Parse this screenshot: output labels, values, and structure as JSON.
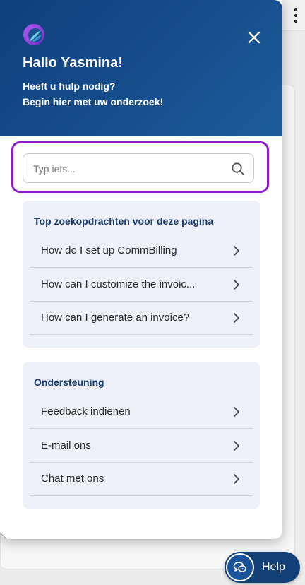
{
  "widget": {
    "greeting": "Hallo Yasmina!",
    "subtitle_line1": "Heeft u hulp nodig?",
    "subtitle_line2": "Begin hier met uw onderzoek!",
    "header_color": "#14467f",
    "accent_outline_color": "#8a1fc9",
    "logo_icon": "brand-logo-icon",
    "close_icon": "close-icon"
  },
  "search": {
    "placeholder": "Typ iets...",
    "value": "",
    "icon": "search-icon"
  },
  "top_searches": {
    "title": "Top zoekopdrachten voor deze pagina",
    "items": [
      {
        "label": "How do I set up CommBilling"
      },
      {
        "label": "How can I customize the invoic..."
      },
      {
        "label": "How can I generate an invoice?"
      }
    ]
  },
  "support": {
    "title": "Ondersteuning",
    "items": [
      {
        "label": "Feedback indienen"
      },
      {
        "label": "E-mail ons"
      },
      {
        "label": "Chat met ons"
      }
    ]
  },
  "help_button": {
    "label": "Help",
    "icon": "chat-bubbles-icon"
  }
}
